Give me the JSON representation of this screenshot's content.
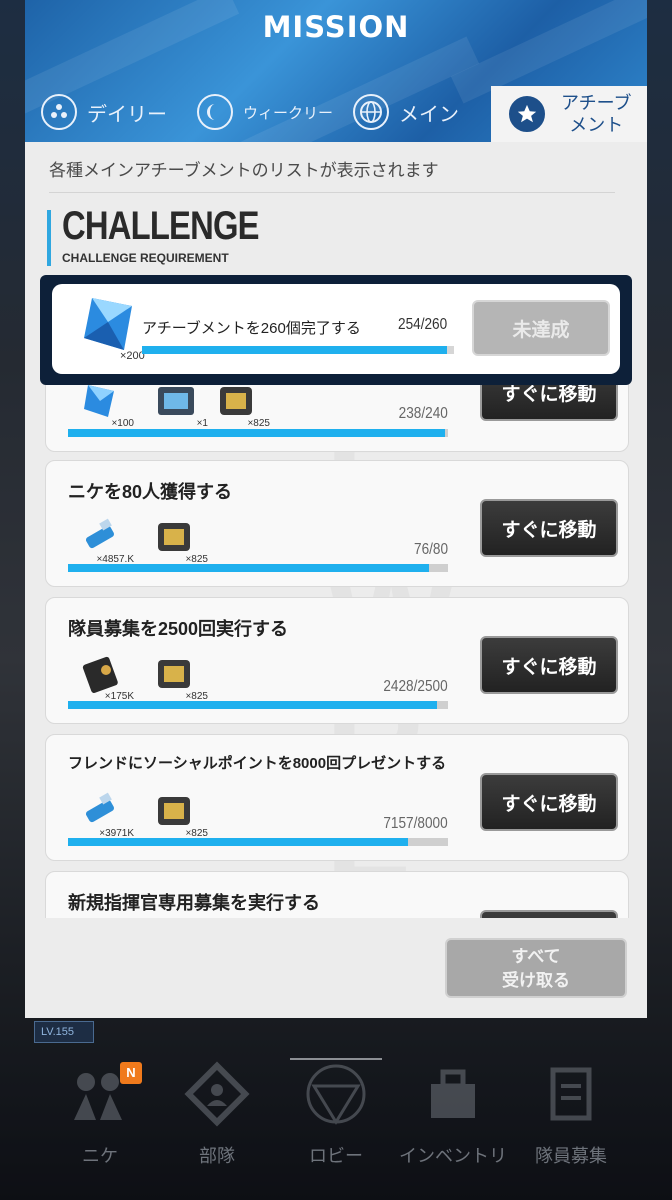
{
  "header": {
    "title": "MISSION"
  },
  "tabs": [
    {
      "label": "デイリー",
      "icon": "daily-icon"
    },
    {
      "label": "ウィークリー",
      "icon": "weekly-icon"
    },
    {
      "label": "メイン",
      "icon": "globe-icon"
    },
    {
      "label": "アチーブ\nメント",
      "icon": "star-icon",
      "active": true
    }
  ],
  "description": "各種メインアチーブメントのリストが表示されます",
  "section": {
    "title": "CHALLENGE",
    "subtitle": "CHALLENGE REQUIREMENT"
  },
  "highlight": {
    "title": "アチーブメントを260個完了する",
    "progress_text": "254/260",
    "progress": 0.977,
    "reward_qty": "×200",
    "button": "未達成"
  },
  "missions": [
    {
      "title": "",
      "rewards": [
        {
          "icon": "gem-icon",
          "qty": "×100"
        },
        {
          "icon": "chip-box-icon",
          "qty": "×1"
        },
        {
          "icon": "credit-case-icon",
          "qty": "×825"
        }
      ],
      "progress_text": "238/240",
      "progress": 0.992,
      "button": "すぐに移動"
    },
    {
      "title": "ニケを80人獲得する",
      "rewards": [
        {
          "icon": "usb-drive-icon",
          "qty": "×4857.K"
        },
        {
          "icon": "credit-case-icon",
          "qty": "×825"
        }
      ],
      "progress_text": "76/80",
      "progress": 0.95,
      "button": "すぐに移動"
    },
    {
      "title": "隊員募集を2500回実行する",
      "rewards": [
        {
          "icon": "voucher-icon",
          "qty": "×175K"
        },
        {
          "icon": "credit-case-icon",
          "qty": "×825"
        }
      ],
      "progress_text": "2428/2500",
      "progress": 0.971,
      "button": "すぐに移動"
    },
    {
      "title": "フレンドにソーシャルポイントを8000回プレゼントする",
      "rewards": [
        {
          "icon": "usb-drive-icon",
          "qty": "×3971K"
        },
        {
          "icon": "credit-case-icon",
          "qty": "×825"
        }
      ],
      "progress_text": "7157/8000",
      "progress": 0.895,
      "button": "すぐに移動"
    },
    {
      "title": "新規指揮官専用募集を実行する",
      "rewards": [],
      "progress_text": "",
      "progress": 0,
      "button": ""
    }
  ],
  "claim_all": "すべて\n受け取る",
  "nav": [
    {
      "label": "ニケ",
      "icon": "nikke-icon"
    },
    {
      "label": "部隊",
      "icon": "squad-icon"
    },
    {
      "label": "ロビー",
      "icon": "lobby-icon"
    },
    {
      "label": "インベントリ",
      "icon": "inventory-icon"
    },
    {
      "label": "隊員募集",
      "icon": "recruit-icon"
    }
  ],
  "nav_badge": "N",
  "level": "LV.155",
  "colors": {
    "accent": "#1fb0ee",
    "header": "#2a7cc4",
    "button_dark": "#2a2a2a",
    "badge": "#f07a1c"
  }
}
